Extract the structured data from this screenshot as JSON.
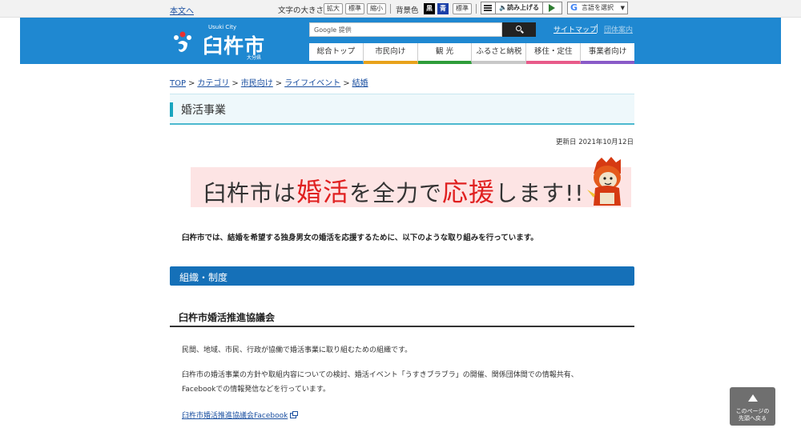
{
  "utility": {
    "skip_link": "本文へ",
    "font_size_label": "文字の大きさ",
    "font_size_buttons": [
      "拡大",
      "標準",
      "縮小"
    ],
    "bg_color_label": "背景色",
    "bg_color_buttons": [
      {
        "label": "黒",
        "color": "#000000"
      },
      {
        "label": "青",
        "color": "#1a3fa8"
      }
    ],
    "bg_standard": "標準",
    "read_aloud": "読み上げる",
    "language_select": "言語を選択"
  },
  "header": {
    "logo_sub": "Usuki City",
    "logo_name": "臼杵市",
    "logo_pref": "大分県",
    "search_placeholder": "Google 提供",
    "links": [
      "サイトマップ",
      "団体案内"
    ],
    "brand_color": "#1f88d1"
  },
  "gnav": [
    {
      "label": "総合トップ",
      "color": "#1f88d1"
    },
    {
      "label": "市民向け",
      "color": "#e8a21b"
    },
    {
      "label": "観 光",
      "color": "#2e9d3a"
    },
    {
      "label": "ふるさと納税",
      "color": "#c8c8c8"
    },
    {
      "label": "移住・定住",
      "color": "#e85a8a"
    },
    {
      "label": "事業者向け",
      "color": "#8a5ac8"
    }
  ],
  "breadcrumb": [
    "TOP",
    "カテゴリ",
    "市民向け",
    "ライフイベント",
    "結婚"
  ],
  "page": {
    "title": "婚活事業",
    "updated": "更新日 2021年10月12日",
    "banner": {
      "part1": "臼杵市は",
      "part2": "婚活",
      "part3": "を全力で",
      "part4": "応援",
      "part5": "します!!"
    },
    "intro": "臼杵市では、結婚を希望する独身男女の婚活を応援するために、以下のような取り組みを行っています。",
    "section_heading": "組織・制度",
    "subheading": "臼杵市婚活推進協議会",
    "paragraph1": "民間、地域、市民、行政が協働で婚活事業に取り組むための組織です。",
    "paragraph2_line1": "臼杵市の婚活事業の方針や取組内容についての検討、婚活イベント「うすきブラブラ」の開催、関係団体間での情報共有、",
    "paragraph2_line2": "Facebookでの情報発信などを行っています。",
    "facebook_link": "臼杵市婚活推進協議会Facebook"
  },
  "back_to_top": {
    "line1": "このページの",
    "line2": "先頭へ戻る"
  }
}
